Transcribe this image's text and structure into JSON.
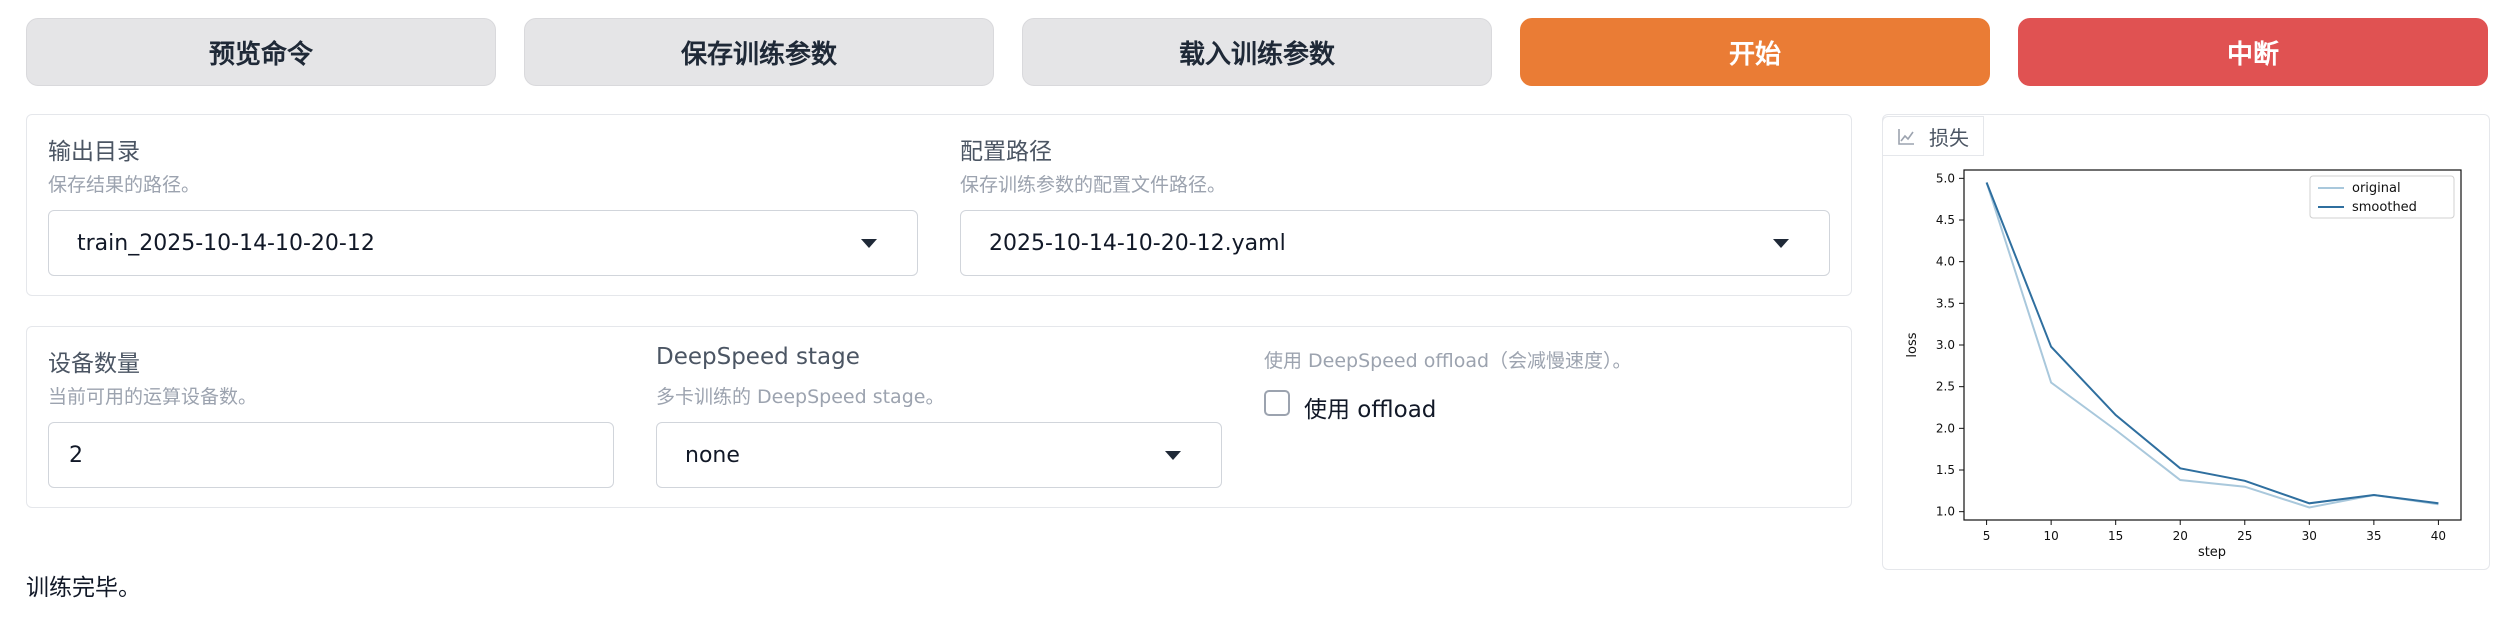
{
  "buttons": {
    "preview": "预览命令",
    "save": "保存训练参数",
    "load": "载入训练参数",
    "start": "开始",
    "abort": "中断"
  },
  "output_dir": {
    "label": "输出目录",
    "info": "保存结果的路径。",
    "value": "train_2025-10-14-10-20-12"
  },
  "config_path": {
    "label": "配置路径",
    "info": "保存训练参数的配置文件路径。",
    "value": "2025-10-14-10-20-12.yaml"
  },
  "device_count": {
    "label": "设备数量",
    "info": "当前可用的运算设备数。",
    "value": "2"
  },
  "ds_stage": {
    "label": "DeepSpeed stage",
    "info": "多卡训练的 DeepSpeed stage。",
    "value": "none"
  },
  "ds_offload": {
    "info": "使用 DeepSpeed offload（会减慢速度）。",
    "label": "使用 offload",
    "checked": false
  },
  "plot": {
    "tab_label": "损失",
    "icon": "chart-icon"
  },
  "status_text": "训练完毕。",
  "colors": {
    "accent": "#ea7c35",
    "stop": "#e05252",
    "original_line": "#a9c8dc",
    "smoothed_line": "#2f6f9f"
  },
  "chart_data": {
    "type": "line",
    "xlabel": "step",
    "ylabel": "loss",
    "x": [
      5,
      10,
      15,
      20,
      25,
      30,
      35,
      40
    ],
    "xlim": [
      3.25,
      41.75
    ],
    "ylim": [
      0.9,
      5.1
    ],
    "xticks": [
      "5",
      "10",
      "15",
      "20",
      "25",
      "30",
      "35",
      "40"
    ],
    "yticks": [
      "1.0",
      "1.5",
      "2.0",
      "2.5",
      "3.0",
      "3.5",
      "4.0",
      "4.5",
      "5.0"
    ],
    "legend": "top-right",
    "series": [
      {
        "name": "original",
        "values": [
          4.95,
          2.55,
          1.98,
          1.38,
          1.3,
          1.05,
          1.2,
          1.09
        ]
      },
      {
        "name": "smoothed",
        "values": [
          4.95,
          2.98,
          2.16,
          1.52,
          1.37,
          1.1,
          1.2,
          1.1
        ]
      }
    ]
  }
}
